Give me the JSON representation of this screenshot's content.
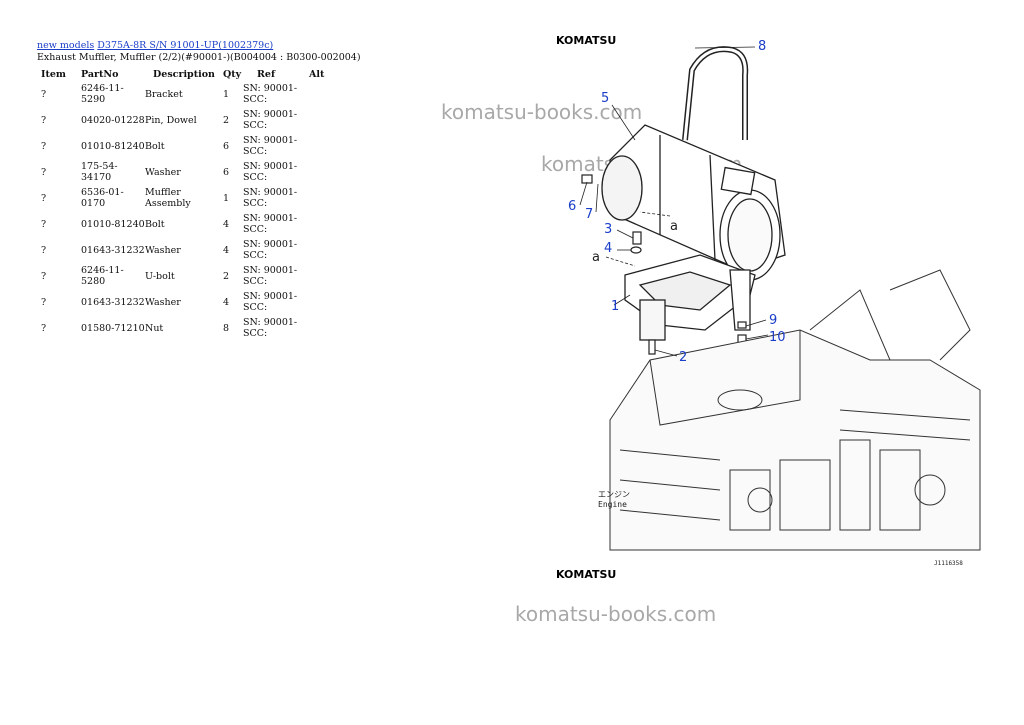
{
  "breadcrumb": {
    "link1": "new models",
    "link2": "D375A-8R S/N 91001-UP(1002379c)"
  },
  "page_title": "Exhaust Muffler, Muffler (2/2)(#90001-)(B004004 : B0300-002004)",
  "table": {
    "headers": [
      "Item",
      "PartNo",
      "Description",
      "Qty",
      "Ref",
      "Alt"
    ],
    "rows": [
      {
        "item": "?",
        "part": "6246-11-5290",
        "desc": "Bracket",
        "qty": "1",
        "ref": "SN: 90001-\nSCC:"
      },
      {
        "item": "?",
        "part": "04020-01228",
        "desc": "Pin, Dowel",
        "qty": "2",
        "ref": "SN: 90001-\nSCC:"
      },
      {
        "item": "?",
        "part": "01010-81240",
        "desc": "Bolt",
        "qty": "6",
        "ref": "SN: 90001-\nSCC:"
      },
      {
        "item": "?",
        "part": "175-54-34170",
        "desc": "Washer",
        "qty": "6",
        "ref": "SN: 90001-\nSCC:"
      },
      {
        "item": "?",
        "part": "6536-01-0170",
        "desc": "Muffler Assembly",
        "qty": "1",
        "ref": "SN: 90001-\nSCC:"
      },
      {
        "item": "?",
        "part": "01010-81240",
        "desc": "Bolt",
        "qty": "4",
        "ref": "SN: 90001-\nSCC:"
      },
      {
        "item": "?",
        "part": "01643-31232",
        "desc": "Washer",
        "qty": "4",
        "ref": "SN: 90001-\nSCC:"
      },
      {
        "item": "?",
        "part": "6246-11-5280",
        "desc": "U-bolt",
        "qty": "2",
        "ref": "SN: 90001-\nSCC:"
      },
      {
        "item": "?",
        "part": "01643-31232",
        "desc": "Washer",
        "qty": "4",
        "ref": "SN: 90001-\nSCC:"
      },
      {
        "item": "?",
        "part": "01580-71210",
        "desc": "Nut",
        "qty": "8",
        "ref": "SN: 90001-\nSCC:"
      }
    ]
  },
  "diagram": {
    "brand_top": "KOMATSU",
    "brand_bottom": "KOMATSU",
    "callouts": [
      "1",
      "2",
      "3",
      "4",
      "5",
      "6",
      "7",
      "8",
      "9",
      "10"
    ],
    "arrow_labels": [
      "a",
      "a"
    ],
    "engine_label_jp": "エンジン",
    "engine_label": "Engine",
    "drawing_code": "J1116358"
  },
  "watermark": "komatsu-books.com"
}
